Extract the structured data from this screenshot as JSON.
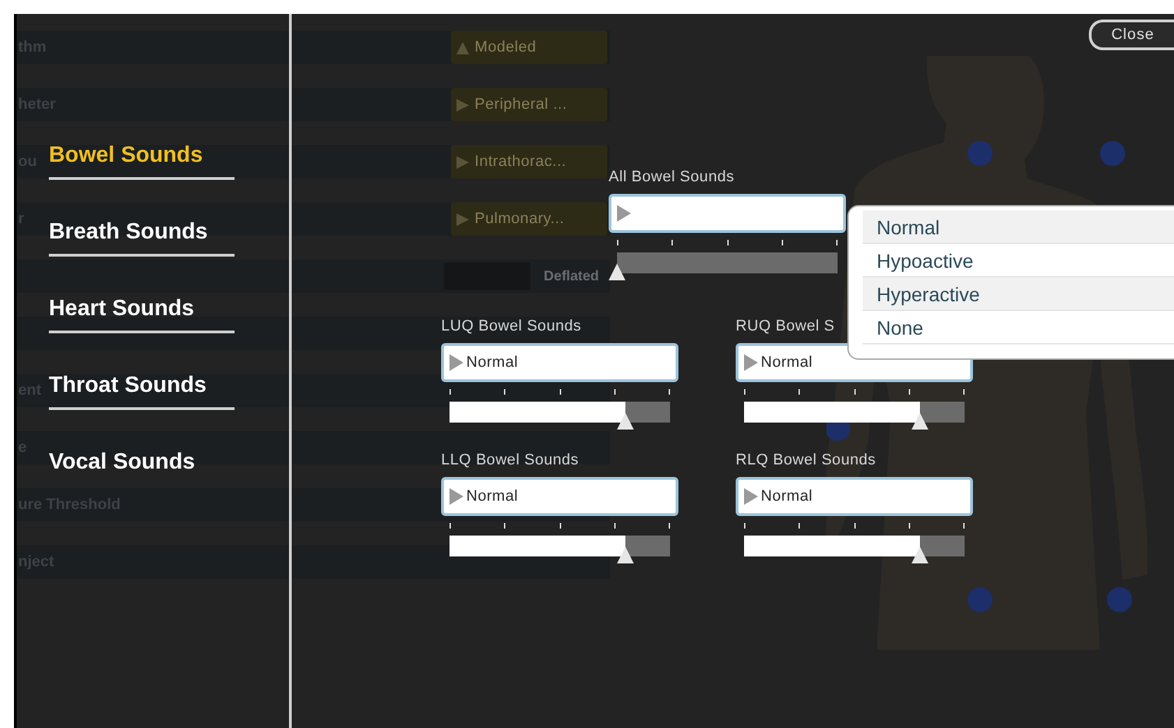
{
  "background_rows": [
    {
      "label": "thm",
      "control": {
        "kind": "mode",
        "text": "Modeled"
      }
    },
    {
      "label": "heter",
      "control": {
        "kind": "dropdown",
        "text": "Peripheral ..."
      }
    },
    {
      "label": "ou",
      "control": {
        "kind": "dropdown",
        "text": "Intrathorac..."
      }
    },
    {
      "label": "r",
      "control": {
        "kind": "dropdown",
        "text": "Pulmonary..."
      }
    },
    {
      "label": "",
      "control": {
        "kind": "toggle",
        "text": "Deflated",
        "on": false
      }
    },
    {
      "label": "",
      "control": {
        "kind": "none"
      }
    },
    {
      "label": "ent",
      "control": {
        "kind": "none"
      }
    },
    {
      "label": "e",
      "control": {
        "kind": "none"
      }
    },
    {
      "label": "ure Threshold",
      "control": {
        "kind": "none"
      }
    },
    {
      "label": "nject",
      "control": {
        "kind": "none"
      }
    }
  ],
  "categories": [
    {
      "label": "Bowel Sounds",
      "selected": true
    },
    {
      "label": "Breath Sounds",
      "selected": false
    },
    {
      "label": "Heart Sounds",
      "selected": false
    },
    {
      "label": "Throat Sounds",
      "selected": false
    },
    {
      "label": "Vocal Sounds",
      "selected": false
    }
  ],
  "all_sounds": {
    "label": "All Bowel Sounds",
    "level": 0
  },
  "dropdown_options": [
    "Normal",
    "Hypoactive",
    "Hyperactive",
    "None"
  ],
  "quadrants": [
    {
      "label": "LUQ Bowel Sounds",
      "value": "Normal",
      "level": 0.8
    },
    {
      "label": "RUQ Bowel S",
      "value": "Normal",
      "level": 0.8
    },
    {
      "label": "LLQ Bowel Sounds",
      "value": "Normal",
      "level": 0.8
    },
    {
      "label": "RLQ Bowel Sounds",
      "value": "Normal",
      "level": 0.8
    }
  ],
  "close_button": "Close"
}
